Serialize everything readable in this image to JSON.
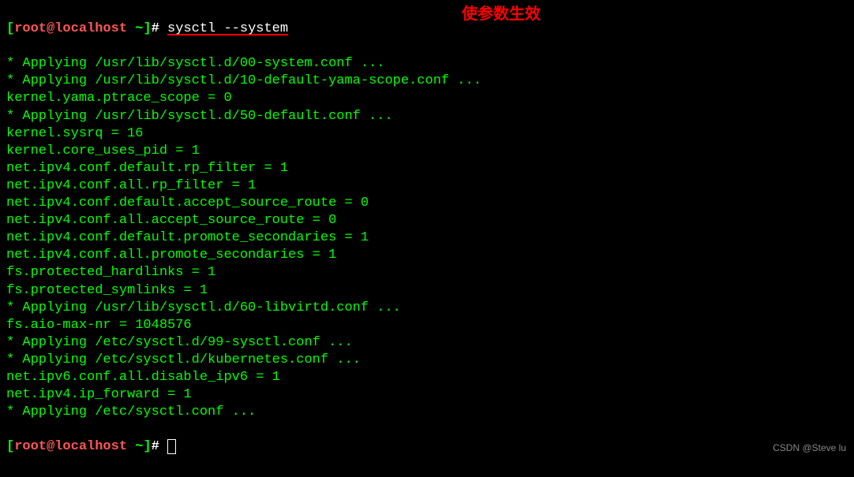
{
  "prompt": {
    "open_bracket": "[",
    "user_host": "root@localhost",
    "path": " ~",
    "close_bracket": "]",
    "hash": "# "
  },
  "command": "sysctl --system",
  "annotation": "使参数生效",
  "output_lines": [
    "* Applying /usr/lib/sysctl.d/00-system.conf ...",
    "* Applying /usr/lib/sysctl.d/10-default-yama-scope.conf ...",
    "kernel.yama.ptrace_scope = 0",
    "* Applying /usr/lib/sysctl.d/50-default.conf ...",
    "kernel.sysrq = 16",
    "kernel.core_uses_pid = 1",
    "net.ipv4.conf.default.rp_filter = 1",
    "net.ipv4.conf.all.rp_filter = 1",
    "net.ipv4.conf.default.accept_source_route = 0",
    "net.ipv4.conf.all.accept_source_route = 0",
    "net.ipv4.conf.default.promote_secondaries = 1",
    "net.ipv4.conf.all.promote_secondaries = 1",
    "fs.protected_hardlinks = 1",
    "fs.protected_symlinks = 1",
    "* Applying /usr/lib/sysctl.d/60-libvirtd.conf ...",
    "fs.aio-max-nr = 1048576",
    "* Applying /etc/sysctl.d/99-sysctl.conf ...",
    "* Applying /etc/sysctl.d/kubernetes.conf ...",
    "net.ipv6.conf.all.disable_ipv6 = 1",
    "net.ipv4.ip_forward = 1",
    "* Applying /etc/sysctl.conf ..."
  ],
  "watermark": "CSDN @Steve lu"
}
